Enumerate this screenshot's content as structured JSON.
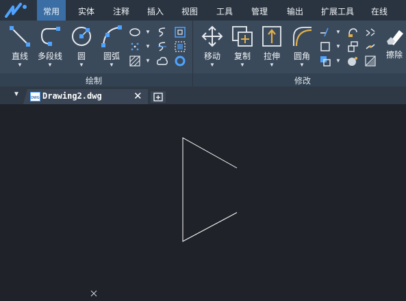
{
  "menu": {
    "tabs": [
      "常用",
      "实体",
      "注释",
      "插入",
      "视图",
      "工具",
      "管理",
      "输出",
      "扩展工具",
      "在线"
    ],
    "active": "常用"
  },
  "ribbon": {
    "draw_group": {
      "label": "绘制",
      "buttons": [
        "直线",
        "多段线",
        "圆",
        "圆弧"
      ]
    },
    "modify_group": {
      "label": "修改",
      "buttons": [
        "移动",
        "复制",
        "拉伸",
        "圆角",
        "擦除"
      ]
    }
  },
  "document_tab": {
    "name": "Drawing2.dwg",
    "badge": "DWG"
  },
  "colors": {
    "accent": "#3a6ea5",
    "ribbon": "#3b4a5b",
    "menubar": "#2a3440",
    "canvas": "#1f2329",
    "icon_blue": "#4fa3ff",
    "icon_gold": "#e3b04b"
  }
}
